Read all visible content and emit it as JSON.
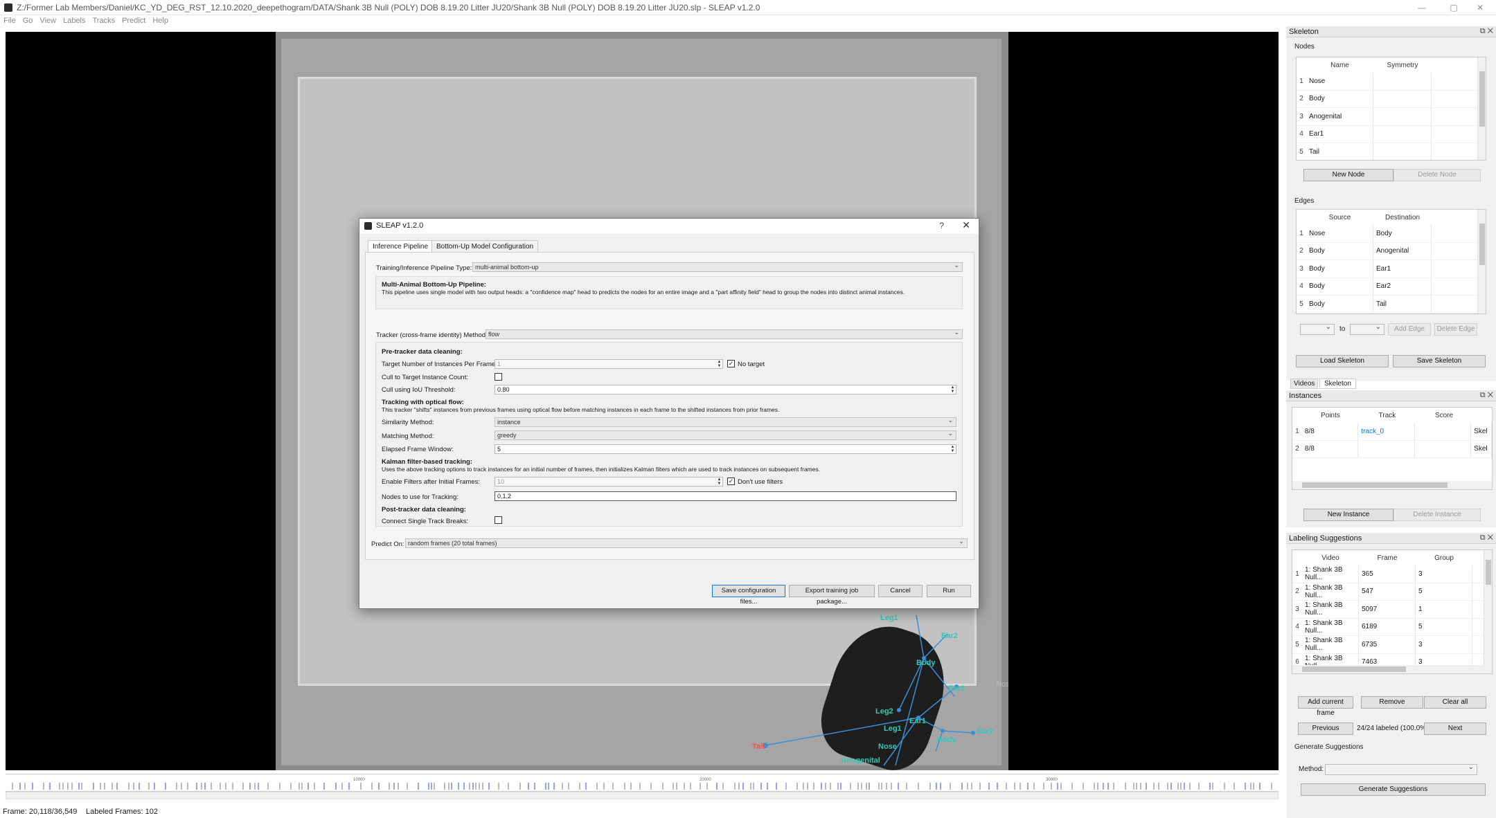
{
  "window": {
    "title": "Z:/Former Lab Members/Daniel/KC_YD_DEG_RST_12.10.2020_deepethogram/DATA/Shank 3B Null (POLY) DOB 8.19.20 Litter JU20/Shank 3B Null (POLY) DOB 8.19.20 Litter JU20.slp - SLEAP v1.2.0",
    "minimize": "—",
    "maximize": "▢",
    "close": "✕"
  },
  "menu": [
    "File",
    "Go",
    "View",
    "Labels",
    "Tracks",
    "Predict",
    "Help"
  ],
  "video": {
    "node_labels": {
      "nose": "Nose",
      "tail": "Tail",
      "body1": "Body",
      "body2": "Body",
      "ear1a": "Ear1",
      "ear2a": "Ear2",
      "ear1b": "Ear1",
      "ear2b": "Ear2",
      "leg1a": "Leg1",
      "leg1b": "Leg1",
      "leg2": "Leg2",
      "anogenital": "Anogenital",
      "nose2": "Nose"
    }
  },
  "timeline": {
    "ticks": [
      "10000",
      "20000",
      "30000"
    ]
  },
  "status": {
    "frame": "Frame: 20,118/36,549",
    "labeled": "Labeled Frames: 102"
  },
  "skeleton_panel": {
    "title": "Skeleton",
    "nodes_label": "Nodes",
    "nodes_headers": [
      "Name",
      "Symmetry"
    ],
    "nodes": [
      {
        "n": "1",
        "name": "Nose",
        "sym": ""
      },
      {
        "n": "2",
        "name": "Body",
        "sym": ""
      },
      {
        "n": "3",
        "name": "Anogenital",
        "sym": ""
      },
      {
        "n": "4",
        "name": "Ear1",
        "sym": ""
      },
      {
        "n": "5",
        "name": "Tail",
        "sym": ""
      }
    ],
    "new_node": "New Node",
    "delete_node": "Delete Node",
    "edges_label": "Edges",
    "edges_headers": [
      "Source",
      "Destination"
    ],
    "edges": [
      {
        "n": "1",
        "src": "Nose",
        "dst": "Body"
      },
      {
        "n": "2",
        "src": "Body",
        "dst": "Anogenital"
      },
      {
        "n": "3",
        "src": "Body",
        "dst": "Ear1"
      },
      {
        "n": "4",
        "src": "Body",
        "dst": "Ear2"
      },
      {
        "n": "5",
        "src": "Body",
        "dst": "Tail"
      }
    ],
    "to_label": "to",
    "add_edge": "Add Edge",
    "delete_edge": "Delete Edge",
    "load_skeleton": "Load Skeleton",
    "save_skeleton": "Save Skeleton",
    "tabs": [
      "Videos",
      "Skeleton"
    ]
  },
  "instances_panel": {
    "title": "Instances",
    "headers": [
      "Points",
      "Track",
      "Score"
    ],
    "rows": [
      {
        "n": "1",
        "points": "8/8",
        "track": "track_0",
        "score": "",
        "skel": "Skel"
      },
      {
        "n": "2",
        "points": "8/8",
        "track": "",
        "score": "",
        "skel": "Skel"
      }
    ],
    "new_instance": "New Instance",
    "delete_instance": "Delete Instance"
  },
  "suggestions_panel": {
    "title": "Labeling Suggestions",
    "headers": [
      "Video",
      "Frame",
      "Group"
    ],
    "rows": [
      {
        "n": "1",
        "video": "1: Shank 3B Null...",
        "frame": "365",
        "group": "3"
      },
      {
        "n": "2",
        "video": "1: Shank 3B Null...",
        "frame": "547",
        "group": "5"
      },
      {
        "n": "3",
        "video": "1: Shank 3B Null...",
        "frame": "5097",
        "group": "1"
      },
      {
        "n": "4",
        "video": "1: Shank 3B Null...",
        "frame": "6189",
        "group": "5"
      },
      {
        "n": "5",
        "video": "1: Shank 3B Null...",
        "frame": "6735",
        "group": "3"
      },
      {
        "n": "6",
        "video": "1: Shank 3B Null...",
        "frame": "7463",
        "group": "3"
      }
    ],
    "add_current": "Add current frame",
    "remove": "Remove",
    "clear_all": "Clear all",
    "previous": "Previous",
    "progress": "24/24 labeled (100.0%)",
    "next": "Next",
    "generate_label": "Generate Suggestions",
    "method_label": "Method:",
    "method_value": "",
    "generate_button": "Generate Suggestions"
  },
  "dialog": {
    "title": "SLEAP v1.2.0",
    "help": "?",
    "close": "✕",
    "tabs": [
      "Inference Pipeline",
      "Bottom-Up Model Configuration"
    ],
    "pipeline_type_label": "Training/Inference Pipeline Type:",
    "pipeline_type_value": "multi-animal bottom-up",
    "desc_title": "Multi-Animal Bottom-Up Pipeline:",
    "desc_text": "This pipeline uses single model with two output heads: a \"confidence map\" head to predicts the nodes for an entire image and a \"part affinity field\" head to group the nodes into distinct animal instances.",
    "tracker_label": "Tracker (cross-frame identity) Method:",
    "tracker_value": "flow",
    "pre_clean": "Pre-tracker data cleaning:",
    "target_instances_label": "Target Number of Instances Per Frame:",
    "target_instances_value": "1",
    "no_target": "No target",
    "cull_label": "Cull to Target Instance Count:",
    "iou_label": "Cull using IoU Threshold:",
    "iou_value": "0.80",
    "flow_title": "Tracking with optical flow:",
    "flow_text": "This tracker \"shifts\" instances from previous frames using optical flow before matching instances in each frame to the shifted instances from prior frames.",
    "similarity_label": "Similarity Method:",
    "similarity_value": "instance",
    "matching_label": "Matching Method:",
    "matching_value": "greedy",
    "window_label": "Elapsed Frame Window:",
    "window_value": "5",
    "kalman_title": "Kalman filter-based tracking:",
    "kalman_text": "Uses the above tracking options to track instances for an initial number of frames, then initializes Kalman filters which are used to track instances on subsequent frames.",
    "filters_label": "Enable Filters after Initial Frames:",
    "filters_value": "10",
    "dont_use": "Don't use filters",
    "nodes_label": "Nodes to use for Tracking:",
    "nodes_value": "0,1,2",
    "post_clean": "Post-tracker data cleaning:",
    "connect_label": "Connect Single Track Breaks:",
    "predict_on_label": "Predict On:",
    "predict_on_value": "random frames (20 total frames)",
    "save_config": "Save configuration files...",
    "export": "Export training job package...",
    "cancel": "Cancel",
    "run": "Run"
  },
  "colors": {
    "accent": "#0078d7",
    "skeleton_edge": "#3a8fd8",
    "node_label": "#37c7b4",
    "tail_label": "#ff4d4d",
    "timeline_labeled": "#3344cc"
  }
}
